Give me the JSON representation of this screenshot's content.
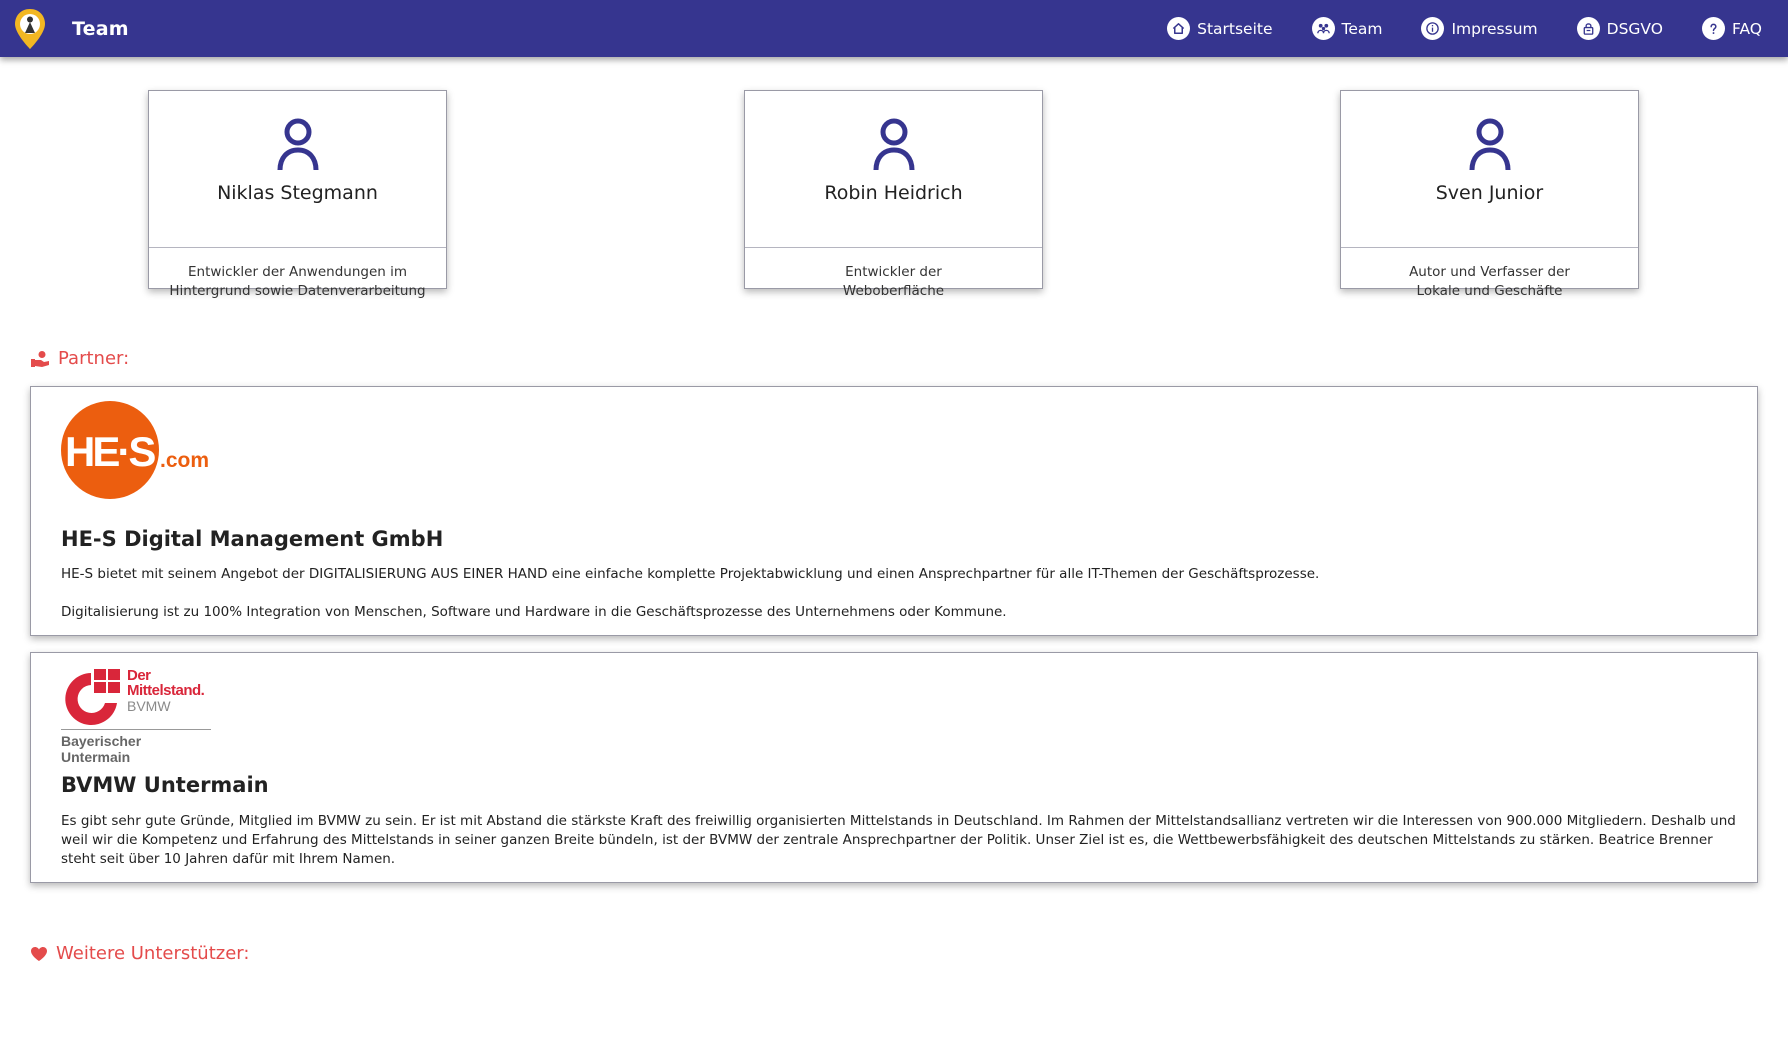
{
  "app": {
    "title": "Team"
  },
  "nav": [
    {
      "label": "Startseite",
      "icon": "home-icon"
    },
    {
      "label": "Team",
      "icon": "people-icon"
    },
    {
      "label": "Impressum",
      "icon": "info-icon"
    },
    {
      "label": "DSGVO",
      "icon": "lock-icon"
    },
    {
      "label": "FAQ",
      "icon": "question-icon"
    }
  ],
  "team": [
    {
      "name": "Niklas Stegmann",
      "role": "Entwickler der Anwendungen im Hintergrund sowie Datenverarbeitung"
    },
    {
      "name": "Robin Heidrich",
      "role": "Entwickler der Weboberfläche"
    },
    {
      "name": "Sven Junior",
      "role": "Autor und Verfasser der Lokale und Geschäfte"
    }
  ],
  "partners_heading": "Partner:",
  "partners": [
    {
      "name": "HE-S Digital Management GmbH",
      "logo_text": "HE·S",
      "logo_suffix": ".com",
      "text1": "HE-S bietet mit seinem Angebot der DIGITALISIERUNG AUS EINER HAND eine einfache komplette Projektabwicklung und einen Ansprechpartner für alle IT-Themen der Geschäftsprozesse.",
      "text2": "Digitalisierung ist zu 100% Integration von Menschen, Software und Hardware in die Geschäftsprozesse des Unternehmens oder Kommune."
    },
    {
      "name": "BVMW Untermain",
      "logo_line1": "Der",
      "logo_line2": "Mittelstand.",
      "logo_line3": "BVMW",
      "logo_region": "Bayerischer Untermain",
      "text1": "Es gibt sehr gute Gründe, Mitglied im BVMW zu sein. Er ist mit Abstand die stärkste Kraft des freiwillig organisierten Mittelstands in Deutschland. Im Rahmen der Mittelstandsallianz vertreten wir die Interessen von 900.000 Mitgliedern. Deshalb und weil wir die Kompetenz und Erfahrung des Mittelstands in seiner ganzen Breite bündeln, ist der BVMW der zentrale Ansprechpartner der Politik. Unser Ziel ist es, die Wettbewerbsfähigkeit des deutschen Mittelstands zu stärken. Beatrice Brenner steht seit über 10 Jahren dafür mit Ihrem Namen."
    }
  ],
  "supporters_heading": "Weitere Unterstützer:",
  "colors": {
    "navbar": "#36358f",
    "accent": "#e44b4b",
    "icon": "#36358f",
    "hes_orange": "#ec5e0f",
    "bvmw_red": "#d9263a"
  }
}
